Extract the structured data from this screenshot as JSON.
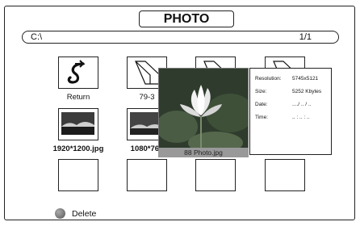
{
  "header": {
    "title": "PHOTO"
  },
  "path": {
    "location": "C:\\",
    "page": "1/1"
  },
  "grid": {
    "row1": [
      {
        "label": "Return",
        "kind": "return-icon"
      },
      {
        "label": "79-3",
        "kind": "folder-icon"
      },
      {
        "label": "",
        "kind": "folder-icon"
      },
      {
        "label": "",
        "kind": "folder-icon"
      }
    ],
    "row2": [
      {
        "label": "1920*1200.jpg",
        "kind": "image-thumbnail"
      },
      {
        "label": "1080*768",
        "kind": "image-thumbnail"
      }
    ]
  },
  "preview": {
    "caption": "88 Photo.jpg"
  },
  "info": {
    "resolution_label": "Resolution:",
    "resolution_value": "5745x5121",
    "size_label": "Size:",
    "size_value": "5252 Kbytes",
    "date_label": "Date:",
    "date_value": "..../ .. / ..",
    "time_label": "Time:",
    "time_value": ".. : .. : .."
  },
  "footer": {
    "delete_label": "Delete"
  }
}
